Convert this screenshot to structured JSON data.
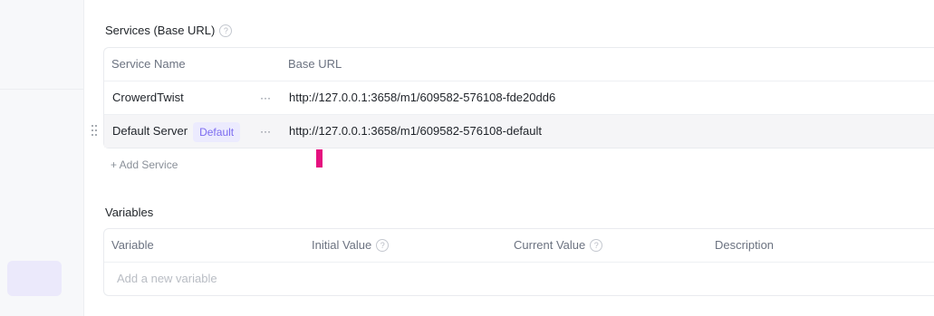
{
  "services": {
    "title": "Services (Base URL)",
    "help_icon": "question-circle-icon",
    "columns": [
      "Service Name",
      "Base URL"
    ],
    "rows": [
      {
        "name": "CrowerdTwist",
        "badge": "",
        "more": "···",
        "url": "http://127.0.0.1:3658/m1/609582-576108-fde20dd6"
      },
      {
        "name": "Default Server",
        "badge": "Default",
        "more": "···",
        "url": "http://127.0.0.1:3658/m1/609582-576108-default"
      }
    ],
    "add_label": "+ Add Service"
  },
  "variables": {
    "title": "Variables",
    "columns": {
      "variable": "Variable",
      "initial": "Initial Value",
      "current": "Current Value",
      "description": "Description"
    },
    "placeholder": "Add a new variable"
  },
  "colors": {
    "accent": "#7c6cf0",
    "badge_bg": "#ecebfe",
    "cursor": "#e5117f",
    "active_nav": "#ebe9fb"
  }
}
